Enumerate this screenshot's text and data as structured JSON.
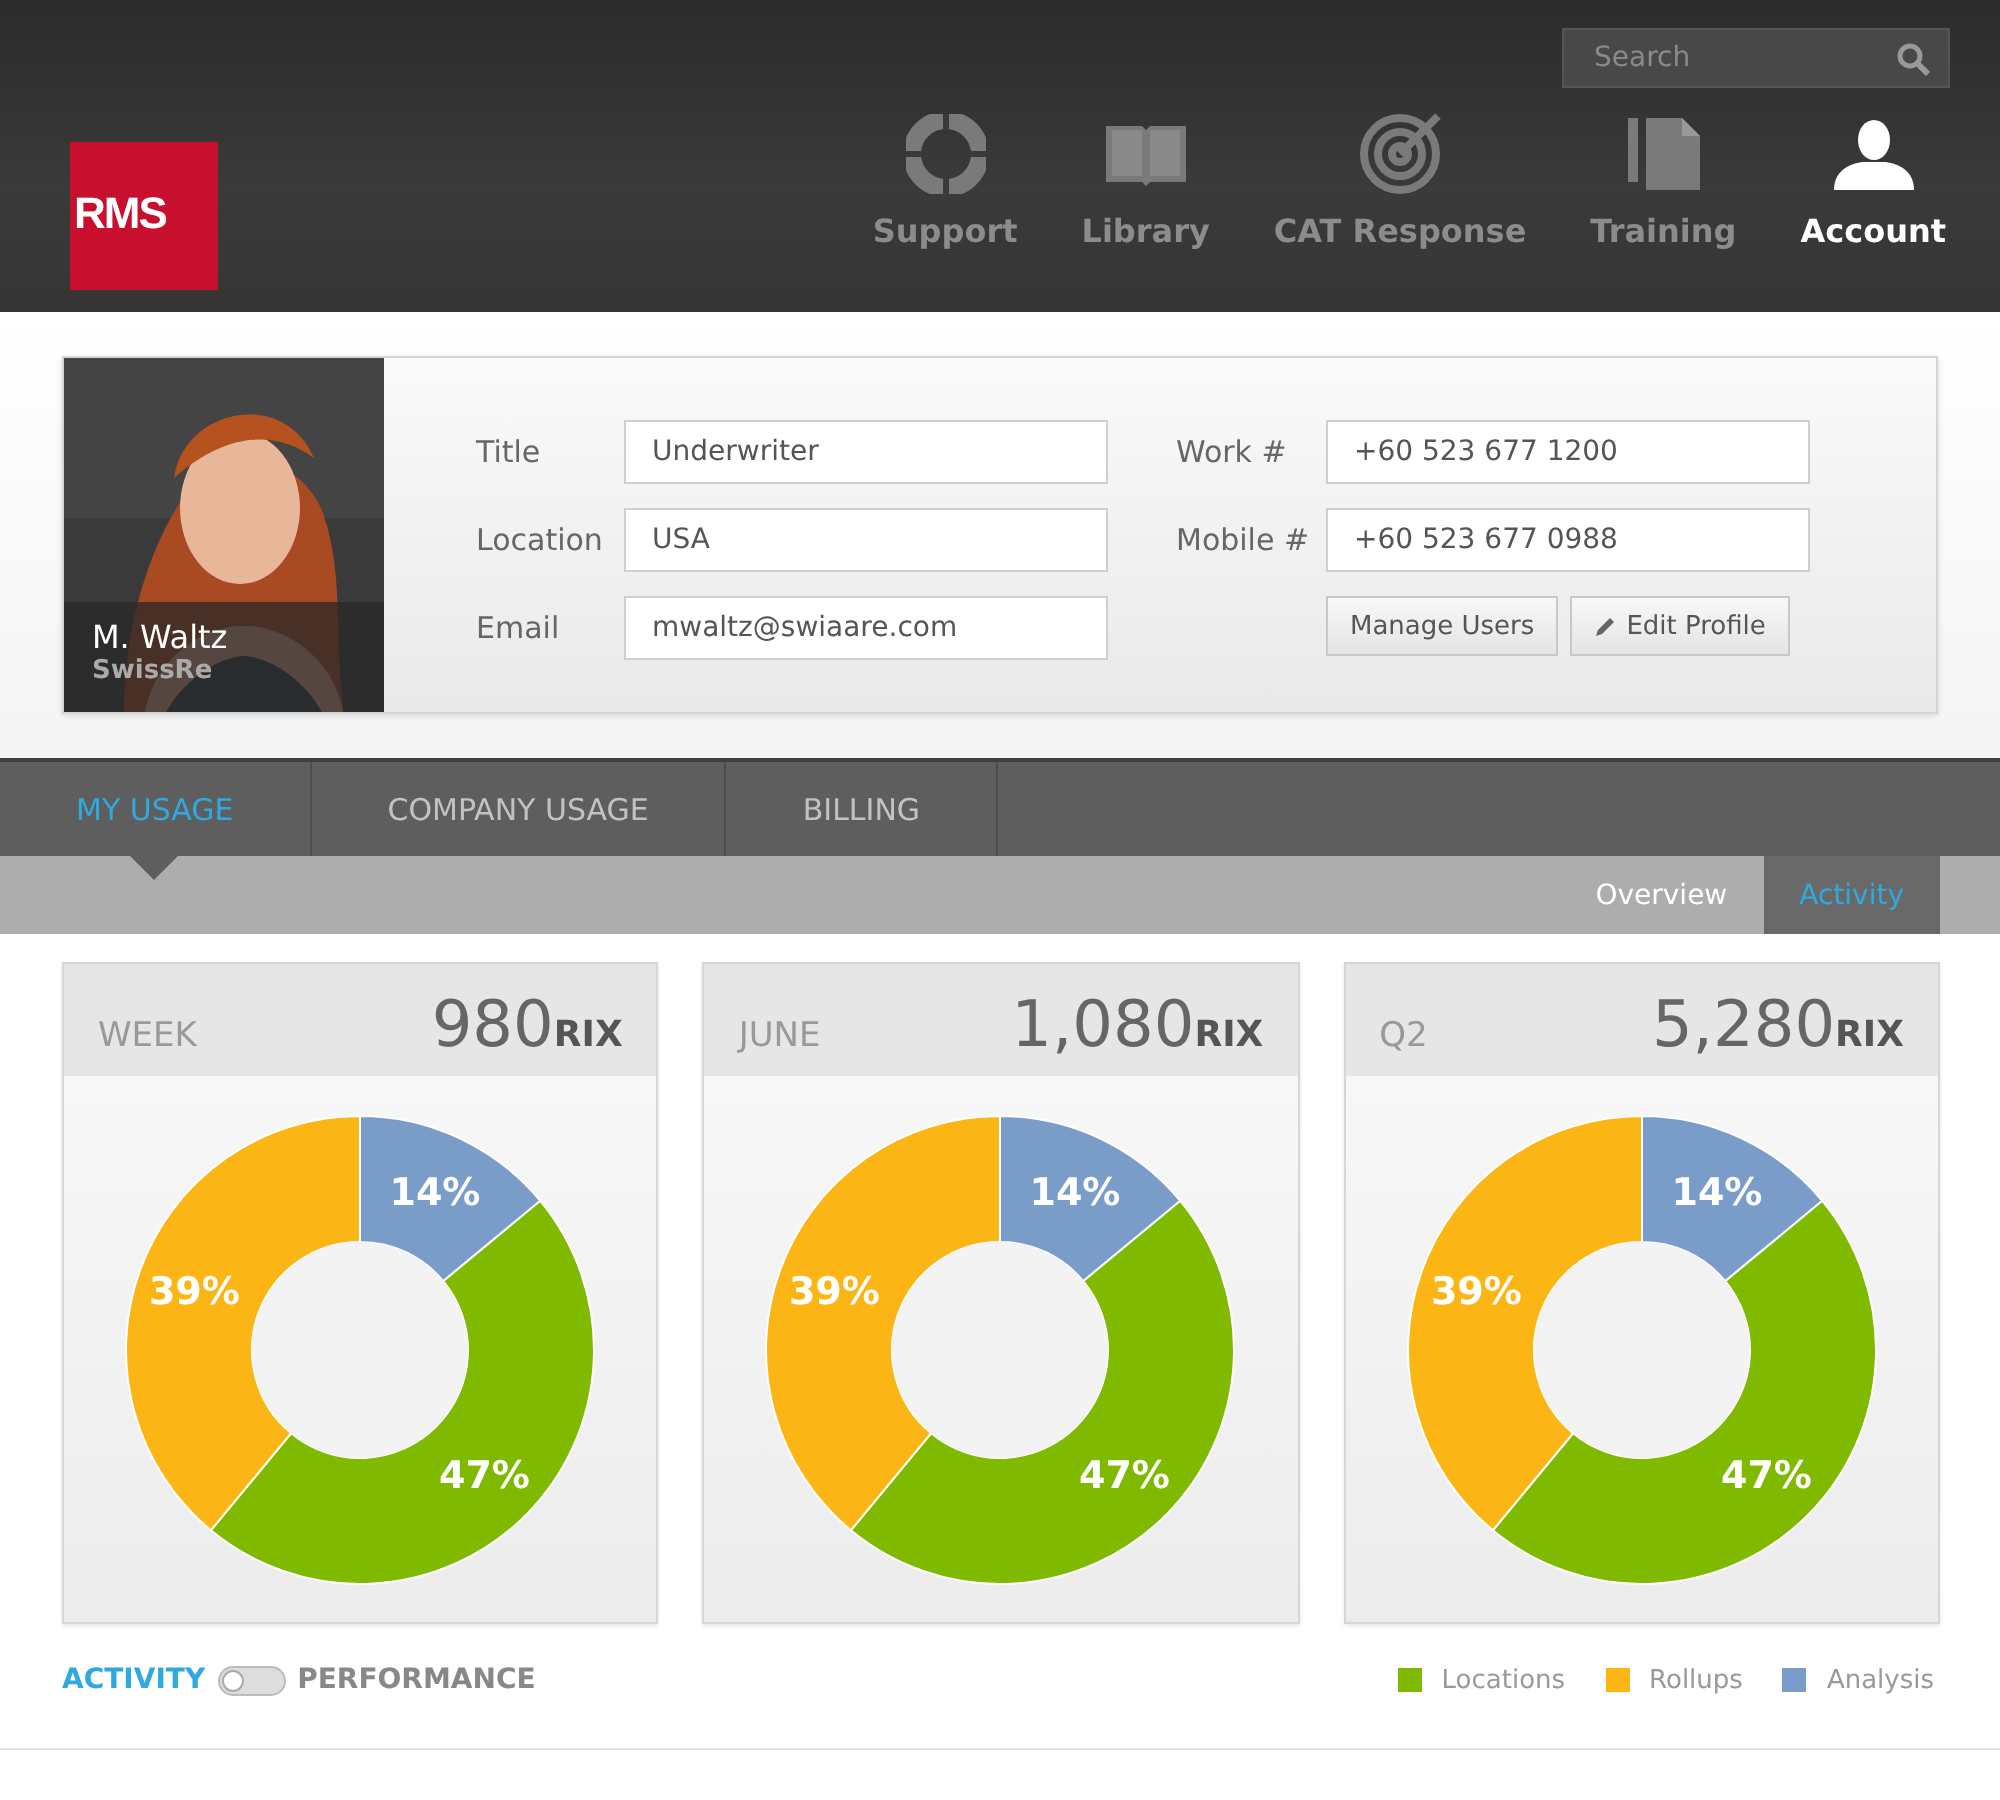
{
  "header": {
    "logo": "RMS",
    "search": {
      "placeholder": "Search"
    },
    "nav": [
      {
        "label": "Support",
        "selected": false
      },
      {
        "label": "Library",
        "selected": false
      },
      {
        "label": "CAT Response",
        "selected": false
      },
      {
        "label": "Training",
        "selected": false
      },
      {
        "label": "Account",
        "selected": true
      }
    ]
  },
  "profile": {
    "name": "M. Waltz",
    "company": "SwissRe",
    "fields_left": [
      {
        "label": "Title",
        "value": "Underwriter"
      },
      {
        "label": "Location",
        "value": "USA"
      },
      {
        "label": "Email",
        "value": "mwaltz@swiaare.com"
      }
    ],
    "fields_right": [
      {
        "label": "Work #",
        "value": "+60 523 677 1200"
      },
      {
        "label": "Mobile #",
        "value": "+60 523 677 0988"
      }
    ],
    "buttons": [
      "Manage Users",
      "Edit Profile"
    ]
  },
  "tabs": [
    {
      "label": "MY USAGE",
      "selected": true
    },
    {
      "label": "COMPANY USAGE",
      "selected": false
    },
    {
      "label": "BILLING",
      "selected": false
    }
  ],
  "subtabs": [
    {
      "label": "Overview",
      "selected": false
    },
    {
      "label": "Activity",
      "selected": true
    }
  ],
  "cards": [
    {
      "period": "WEEK",
      "amount": "980",
      "unit": "RIX",
      "chart_data": {
        "type": "donut",
        "values": [
          14,
          47,
          39
        ],
        "value_labels": [
          "14%",
          "47%",
          "39%"
        ]
      }
    },
    {
      "period": "JUNE",
      "amount": "1,080",
      "unit": "RIX",
      "chart_data": {
        "type": "donut",
        "values": [
          14,
          47,
          39
        ],
        "value_labels": [
          "14%",
          "47%",
          "39%"
        ]
      }
    },
    {
      "period": "Q2",
      "amount": "5,280",
      "unit": "RIX",
      "chart_data": {
        "type": "donut",
        "values": [
          14,
          47,
          39
        ],
        "value_labels": [
          "14%",
          "47%",
          "39%"
        ]
      }
    }
  ],
  "toggle": {
    "left_label": "ACTIVITY",
    "right_label": "PERFORMANCE",
    "on": false
  },
  "legend": [
    {
      "label": "Locations",
      "color": "#7fba00"
    },
    {
      "label": "Rollups",
      "color": "#fbb616"
    },
    {
      "label": "Analysis",
      "color": "#7a9cc9"
    }
  ]
}
